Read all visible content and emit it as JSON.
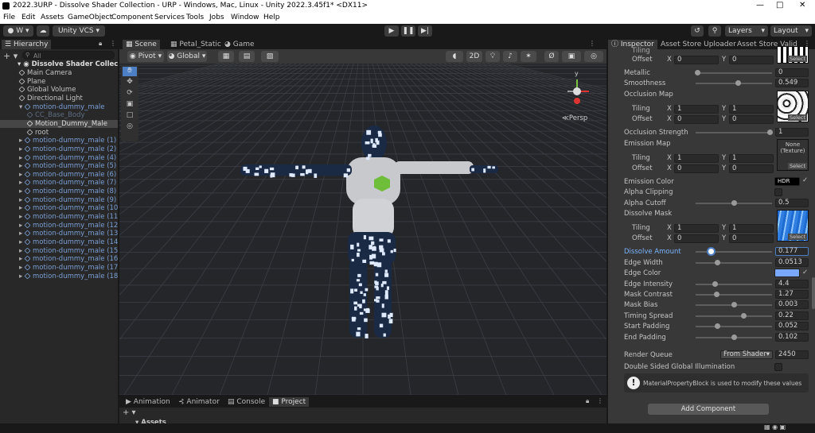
{
  "window": {
    "title": "2022.3URP - Dissolve Shader Collection - URP - Windows, Mac, Linux - Unity 2022.3.45f1* <DX11>"
  },
  "menu": [
    "File",
    "Edit",
    "Assets",
    "GameObject",
    "Component",
    "Services",
    "Tools",
    "Jobs",
    "Window",
    "Help"
  ],
  "toolbar": {
    "account": "W",
    "vcs": "Unity VCS",
    "layers": "Layers",
    "layout": "Layout"
  },
  "hierarchy": {
    "title": "Hierarchy",
    "search_placeholder": "All",
    "scene": "Dissolve Shader Collec",
    "items": [
      {
        "label": "Main Camera",
        "depth": 1
      },
      {
        "label": "Plane",
        "depth": 1
      },
      {
        "label": "Global Volume",
        "depth": 1
      },
      {
        "label": "Directional Light",
        "depth": 1
      },
      {
        "label": "motion-dummy_male",
        "depth": 1,
        "prefab": true
      },
      {
        "label": "CC_Base_Body",
        "depth": 2,
        "dim": true
      },
      {
        "label": "Motion_Dummy_Male",
        "depth": 2,
        "sel": true
      },
      {
        "label": "root",
        "depth": 2
      },
      {
        "label": "motion-dummy_male (1)",
        "depth": 1,
        "prefab": true
      },
      {
        "label": "motion-dummy_male (2)",
        "depth": 1,
        "prefab": true
      },
      {
        "label": "motion-dummy_male (4)",
        "depth": 1,
        "prefab": true
      },
      {
        "label": "motion-dummy_male (5)",
        "depth": 1,
        "prefab": true
      },
      {
        "label": "motion-dummy_male (6)",
        "depth": 1,
        "prefab": true
      },
      {
        "label": "motion-dummy_male (7)",
        "depth": 1,
        "prefab": true
      },
      {
        "label": "motion-dummy_male (8)",
        "depth": 1,
        "prefab": true
      },
      {
        "label": "motion-dummy_male (9)",
        "depth": 1,
        "prefab": true
      },
      {
        "label": "motion-dummy_male (10)",
        "depth": 1,
        "prefab": true
      },
      {
        "label": "motion-dummy_male (11)",
        "depth": 1,
        "prefab": true
      },
      {
        "label": "motion-dummy_male (12)",
        "depth": 1,
        "prefab": true
      },
      {
        "label": "motion-dummy_male (13)",
        "depth": 1,
        "prefab": true
      },
      {
        "label": "motion-dummy_male (14)",
        "depth": 1,
        "prefab": true
      },
      {
        "label": "motion-dummy_male (15)",
        "depth": 1,
        "prefab": true
      },
      {
        "label": "motion-dummy_male (16)",
        "depth": 1,
        "prefab": true
      },
      {
        "label": "motion-dummy_male (17)",
        "depth": 1,
        "prefab": true
      },
      {
        "label": "motion-dummy_male (18)",
        "depth": 1,
        "prefab": true
      }
    ]
  },
  "scene": {
    "tabs": [
      "Scene",
      "Petal_Static",
      "Game"
    ],
    "pivot": "Pivot",
    "global": "Global",
    "mode2d": "2D",
    "persp": "Persp"
  },
  "bottom": {
    "tabs": [
      "Animation",
      "Animator",
      "Console",
      "Project"
    ],
    "assets": "Assets"
  },
  "inspector": {
    "tabs": [
      "Inspector",
      "Asset Store Uploader",
      "Asset Store Valid"
    ],
    "tiling": "Tiling",
    "offset": "Offset",
    "x": "X",
    "y": "Y",
    "select": "Select",
    "props": {
      "metallic": {
        "label": "Metallic",
        "value": "0"
      },
      "smoothness": {
        "label": "Smoothness",
        "value": "0.549"
      },
      "occlusion_map": "Occlusion Map",
      "occ_tiling": [
        "1",
        "1"
      ],
      "occ_offset": [
        "0",
        "0"
      ],
      "occlusion_strength": {
        "label": "Occlusion Strength",
        "value": "1"
      },
      "emission_map": "Emission Map",
      "emission_none": "None (Texture)",
      "em_tiling": [
        "1",
        "1"
      ],
      "em_offset": [
        "0",
        "0"
      ],
      "emission_color": "Emission Color",
      "hdr": "HDR",
      "alpha_clipping": "Alpha Clipping",
      "alpha_cutoff": {
        "label": "Alpha Cutoff",
        "value": "0.5"
      },
      "dissolve_mask": "Dissolve Mask",
      "dm_tiling": [
        "1",
        "1"
      ],
      "dm_offset": [
        "0",
        "0"
      ],
      "dissolve_amount": {
        "label": "Dissolve Amount",
        "value": "0.177"
      },
      "edge_width": {
        "label": "Edge Width",
        "value": "0.0513"
      },
      "edge_color": "Edge Color",
      "edge_intensity": {
        "label": "Edge Intensity",
        "value": "4.4"
      },
      "mask_contrast": {
        "label": "Mask Contrast",
        "value": "1.27"
      },
      "mask_bias": {
        "label": "Mask Bias",
        "value": "0.003"
      },
      "timing_spread": {
        "label": "Timing Spread",
        "value": "0.22"
      },
      "start_padding": {
        "label": "Start Padding",
        "value": "0.052"
      },
      "end_padding": {
        "label": "End Padding",
        "value": "0.102"
      },
      "render_queue": {
        "label": "Render Queue",
        "mode": "From Shader",
        "value": "2450"
      },
      "dsgi": "Double Sided Global Illumination",
      "info": "MaterialPropertyBlock is used to modify these values",
      "add_component": "Add Component",
      "top_offset": [
        "0",
        "0"
      ]
    }
  },
  "colors": {
    "accent": "#4d7fc4",
    "selected_label": "#7ab4ff",
    "edge": "#7aa8ff",
    "prefab": "#7a9fd4"
  }
}
